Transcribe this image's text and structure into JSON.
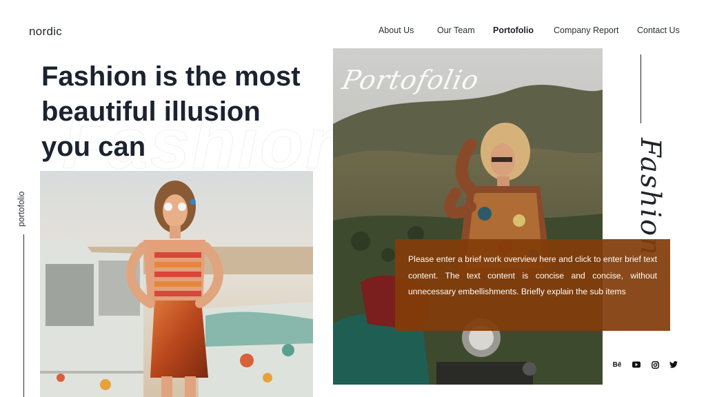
{
  "brand": {
    "logo": "nordic"
  },
  "nav": {
    "items": [
      {
        "label": "About Us",
        "active": false
      },
      {
        "label": "Our Team",
        "active": false
      },
      {
        "label": "Portofolio",
        "active": true
      },
      {
        "label": "Company Report",
        "active": false
      },
      {
        "label": "Contact Us",
        "active": false
      }
    ]
  },
  "hero": {
    "headline": "Fashion is the most beautiful illusion you can",
    "side_label": "portofolio"
  },
  "gallery": {
    "script_title": "Portofolio",
    "vertical_title": "Fashion"
  },
  "overview": {
    "text": "Please enter a brief work overview here and click to enter brief text content. The text content is concise and concise, without unnecessary embellishments. Briefly explain the sub items"
  },
  "socials": {
    "icons": [
      "behance-icon",
      "youtube-icon",
      "instagram-icon",
      "twitter-icon"
    ],
    "behance_label": "Bē"
  },
  "colors": {
    "overlay": "#823c0a",
    "text_dark": "#1b2330"
  }
}
